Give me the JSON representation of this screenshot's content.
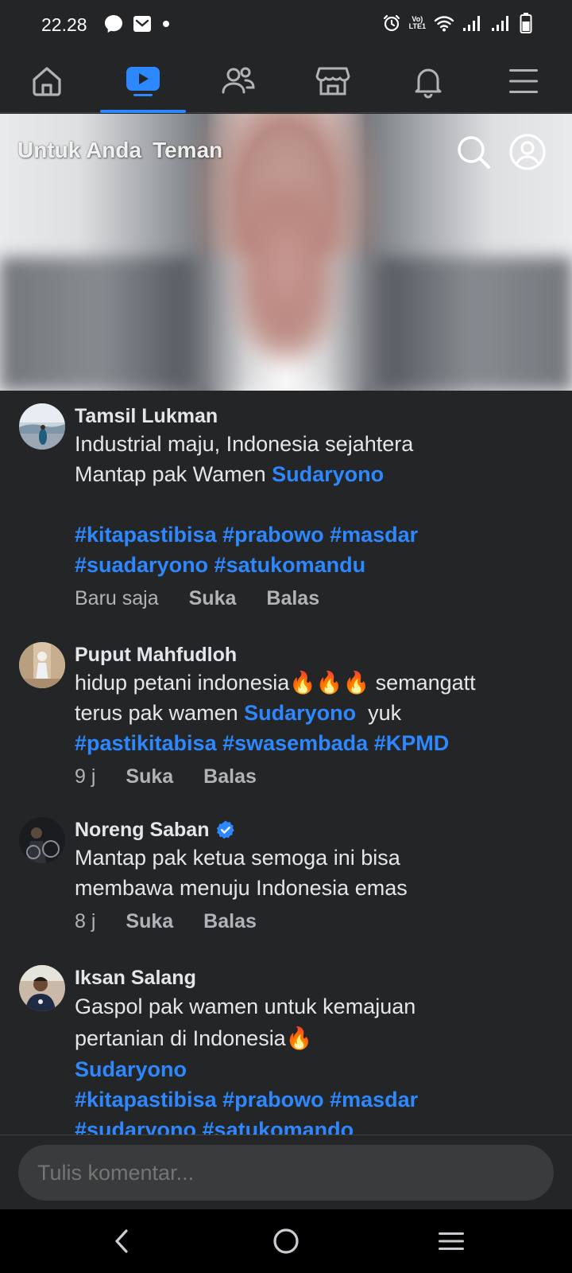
{
  "status_bar": {
    "time": "22.28",
    "icons_left": [
      "messenger-icon",
      "mail-icon",
      "dot-icon"
    ],
    "icons_right": [
      "alarm-icon",
      "volte-icon",
      "wifi-icon",
      "signal-icon",
      "signal-icon",
      "battery-icon"
    ],
    "volte_label_1": "Vo)",
    "volte_label_2": "LTE1"
  },
  "top_nav": {
    "items": [
      {
        "icon": "home-icon",
        "active": false
      },
      {
        "icon": "video-icon",
        "active": true
      },
      {
        "icon": "friends-icon",
        "active": false
      },
      {
        "icon": "marketplace-icon",
        "active": false
      },
      {
        "icon": "bell-icon",
        "active": false
      },
      {
        "icon": "menu-icon",
        "active": false
      }
    ]
  },
  "video": {
    "tabs": [
      "Untuk Anda",
      "Teman"
    ],
    "icons": [
      "search-icon",
      "profile-icon"
    ]
  },
  "comments": [
    {
      "author": "Tamsil Lukman",
      "verified": false,
      "line1": "Industrial maju, Indonesia sejahtera",
      "line2_text": "Mantap pak Wamen ",
      "line2_link": "Sudaryono",
      "hashtags_1": "#kitapastibisa #prabowo #masdar",
      "hashtags_2": "#suadaryono #satukomandu",
      "time": "Baru saja",
      "like": "Suka",
      "reply": "Balas"
    },
    {
      "author": "Puput Mahfudloh",
      "verified": false,
      "line1_text": "hidup petani indonesia",
      "line1_emoji": "🔥🔥🔥",
      "line1_tail": " semangatt",
      "line2_text": "terus pak wamen ",
      "line2_link": "Sudaryono",
      "line2_tail": "  yuk",
      "hashtags_1": "#pastikitabisa #swasembada #KPMD",
      "time": "9 j",
      "like": "Suka",
      "reply": "Balas"
    },
    {
      "author": "Noreng Saban",
      "verified": true,
      "line1": "Mantap pak ketua semoga ini bisa",
      "line2": "membawa menuju Indonesia emas",
      "time": "8 j",
      "like": "Suka",
      "reply": "Balas"
    },
    {
      "author": "Iksan Salang",
      "verified": false,
      "line1": "Gaspol pak wamen untuk kemajuan",
      "line2_text": "pertanian di Indonesia",
      "line2_emoji": "🔥",
      "line3_link": "Sudaryono",
      "hashtags_1": "#kitapastibisa #prabowo #masdar",
      "hashtags_2": "#sudaryono #satukomando"
    }
  ],
  "composer": {
    "placeholder": "Tulis komentar..."
  },
  "system_nav": {
    "icons": [
      "back-icon",
      "home-circle-icon",
      "recents-icon"
    ]
  },
  "colors": {
    "background": "#242526",
    "link": "#2d88ff",
    "text": "#e4e6eb",
    "muted": "#b0b3b8",
    "input_bg": "#3a3b3c",
    "verified": "#2d88ff"
  }
}
